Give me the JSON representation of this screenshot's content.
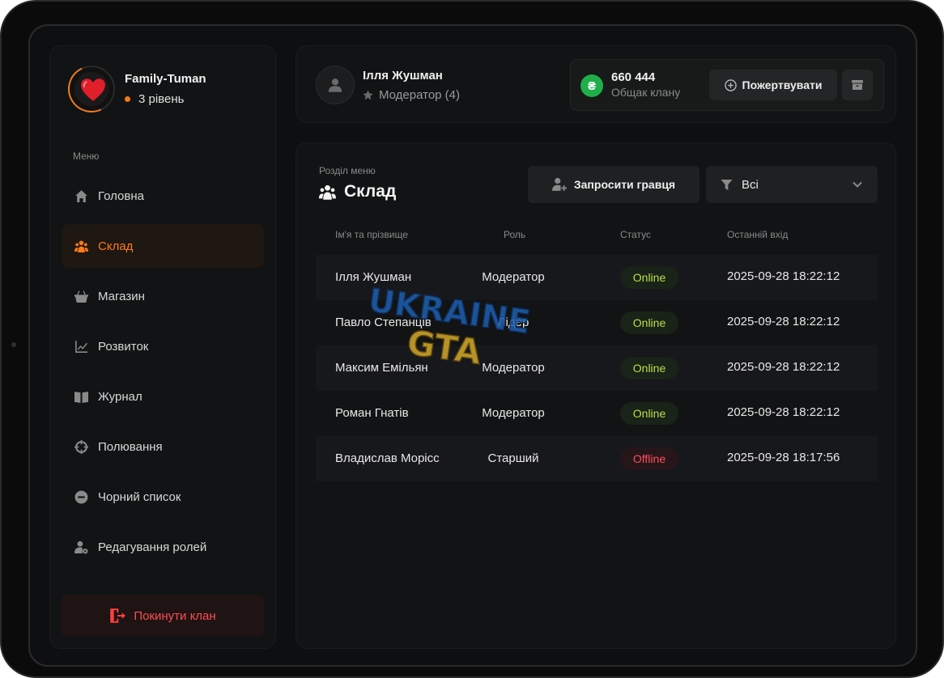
{
  "clan": {
    "name": "Family-Tuman",
    "level": "3 рівень"
  },
  "sidebar": {
    "menu_title": "Меню",
    "items": [
      {
        "label": "Головна",
        "icon": "home-icon"
      },
      {
        "label": "Склад",
        "icon": "users-icon"
      },
      {
        "label": "Магазин",
        "icon": "basket-icon"
      },
      {
        "label": "Розвиток",
        "icon": "chart-icon"
      },
      {
        "label": "Журнал",
        "icon": "book-icon"
      },
      {
        "label": "Полювання",
        "icon": "crosshair-icon"
      },
      {
        "label": "Чорний список",
        "icon": "ban-icon"
      },
      {
        "label": "Редагування ролей",
        "icon": "user-gear-icon"
      }
    ],
    "active_index": 1,
    "leave_label": "Покинути клан"
  },
  "header": {
    "user_name": "Ілля Жушман",
    "user_role": "Модератор (4)",
    "coin_symbol": "₴",
    "balance": "660 444",
    "balance_label": "Общак клану",
    "donate_label": "Пожертвувати"
  },
  "main": {
    "section_label": "Розділ меню",
    "section_title": "Склад",
    "invite_label": "Запросити гравця",
    "filter_value": "Всі",
    "columns": {
      "name": "Ім'я та прізвище",
      "role": "Роль",
      "status": "Статус",
      "last": "Останній вхід"
    },
    "rows": [
      {
        "name": "Ілля Жушман",
        "role": "Модератор",
        "status": "Online",
        "last": "2025-09-28 18:22:12"
      },
      {
        "name": "Павло Степанців",
        "role": "Лідер",
        "status": "Online",
        "last": "2025-09-28 18:22:12"
      },
      {
        "name": "Максим Емільян",
        "role": "Модератор",
        "status": "Online",
        "last": "2025-09-28 18:22:12"
      },
      {
        "name": "Роман Гнатів",
        "role": "Модератор",
        "status": "Online",
        "last": "2025-09-28 18:22:12"
      },
      {
        "name": "Владислав Морісс",
        "role": "Старший",
        "status": "Offline",
        "last": "2025-09-28 18:17:56"
      }
    ]
  },
  "watermark": {
    "line1": "UKRAINE",
    "line2": "GTA"
  },
  "colors": {
    "accent": "#ff7a1a",
    "online": "#b6e04a",
    "offline": "#ff4d5a",
    "danger": "#ff4040",
    "coin": "#1fae4a"
  }
}
